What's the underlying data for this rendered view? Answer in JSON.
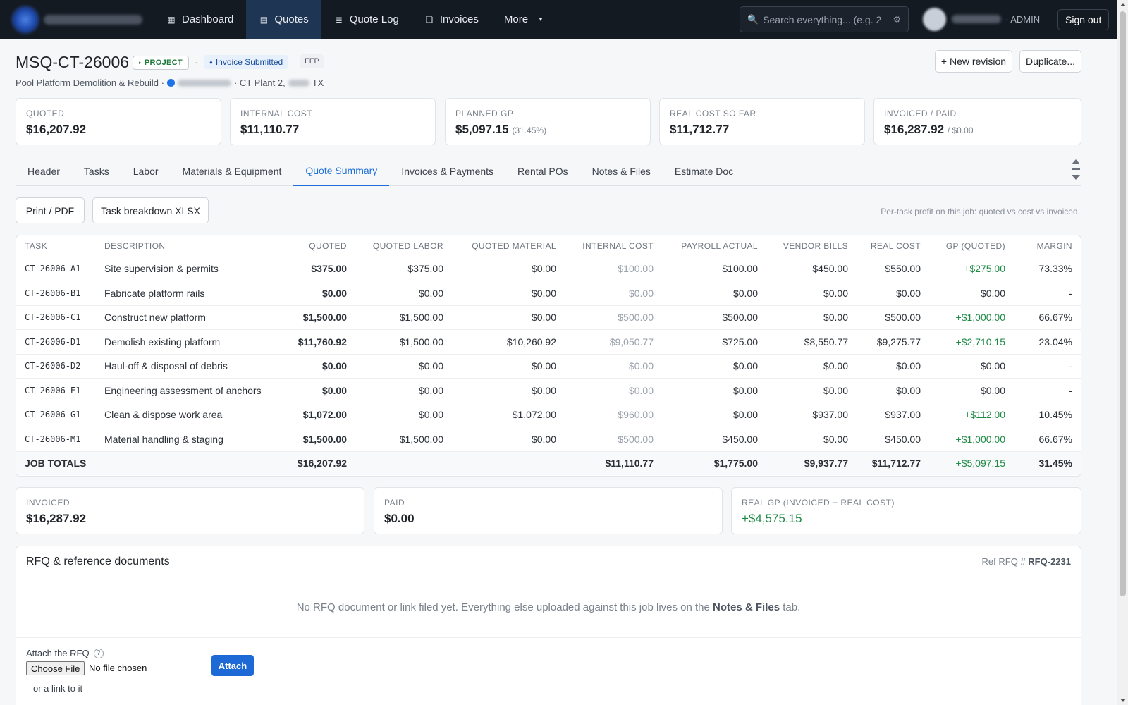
{
  "nav": {
    "items": [
      {
        "label": "Dashboard",
        "icon": "dashboard-icon",
        "glyph": "▦"
      },
      {
        "label": "Quotes",
        "icon": "quotes-icon",
        "glyph": "▤"
      },
      {
        "label": "Quote Log",
        "icon": "list-icon",
        "glyph": "≣"
      },
      {
        "label": "Invoices",
        "icon": "invoice-icon",
        "glyph": "❏"
      },
      {
        "label": "More",
        "icon": "",
        "glyph": ""
      }
    ],
    "search_placeholder": "Search everything... (e.g. 2",
    "role": "· ADMIN",
    "sign_out": "Sign out"
  },
  "job": {
    "id": "MSQ-CT-26006",
    "type_badge": "PROJECT",
    "sep": "·",
    "status_badge": "Invoice Submitted",
    "contract_badge": "FFP",
    "project_name": "Pool Platform Demolition & Rebuild ·",
    "site_label": "· CT Plant 2,",
    "state": "TX",
    "new_revision_label": "+ New revision",
    "duplicate_label": "Duplicate..."
  },
  "kpis": {
    "quoted": {
      "label": "QUOTED",
      "value": "$16,207.92"
    },
    "internal_cost": {
      "label": "INTERNAL COST",
      "value": "$11,110.77"
    },
    "planned_gp": {
      "label": "PLANNED GP",
      "value": "$5,097.15",
      "sub": "(31.45%)"
    },
    "real_cost": {
      "label": "REAL COST SO FAR",
      "value": "$11,712.77"
    },
    "invoiced_paid": {
      "label": "INVOICED / PAID",
      "value": "$16,287.92",
      "sub": "/ $0.00"
    }
  },
  "tabs": [
    "Header",
    "Tasks",
    "Labor",
    "Materials & Equipment",
    "Quote Summary",
    "Invoices & Payments",
    "Rental POs",
    "Notes & Files",
    "Estimate Doc"
  ],
  "actions": {
    "print_label": "Print / PDF",
    "xlsx_label": "Task breakdown XLSX",
    "helper": "Per-task profit on this job: quoted vs cost vs invoiced."
  },
  "table": {
    "headers": {
      "task": "TASK",
      "description": "DESCRIPTION",
      "quoted": "QUOTED",
      "quoted_labor": "QUOTED LABOR",
      "quoted_material": "QUOTED MATERIAL",
      "internal_cost": "INTERNAL COST",
      "payroll_actual": "PAYROLL ACTUAL",
      "vendor_bills": "VENDOR BILLS",
      "real_cost": "REAL COST",
      "gp_quoted": "GP (QUOTED)",
      "margin": "MARGIN"
    },
    "rows": [
      {
        "task": "CT-26006-A1",
        "description": "Site supervision & permits",
        "quoted": "$375.00",
        "quoted_labor": "$375.00",
        "quoted_material": "$0.00",
        "internal_cost": "$100.00",
        "payroll_actual": "$100.00",
        "vendor_bills": "$450.00",
        "real_cost": "$550.00",
        "gp_quoted": "+$275.00",
        "margin": "73.33%"
      },
      {
        "task": "CT-26006-B1",
        "description": "Fabricate platform rails",
        "quoted": "$0.00",
        "quoted_labor": "$0.00",
        "quoted_material": "$0.00",
        "internal_cost": "$0.00",
        "payroll_actual": "$0.00",
        "vendor_bills": "$0.00",
        "real_cost": "$0.00",
        "gp_quoted": "$0.00",
        "margin": "-"
      },
      {
        "task": "CT-26006-C1",
        "description": "Construct new platform",
        "quoted": "$1,500.00",
        "quoted_labor": "$1,500.00",
        "quoted_material": "$0.00",
        "internal_cost": "$500.00",
        "payroll_actual": "$500.00",
        "vendor_bills": "$0.00",
        "real_cost": "$500.00",
        "gp_quoted": "+$1,000.00",
        "margin": "66.67%"
      },
      {
        "task": "CT-26006-D1",
        "description": "Demolish existing platform",
        "quoted": "$11,760.92",
        "quoted_labor": "$1,500.00",
        "quoted_material": "$10,260.92",
        "internal_cost": "$9,050.77",
        "payroll_actual": "$725.00",
        "vendor_bills": "$8,550.77",
        "real_cost": "$9,275.77",
        "gp_quoted": "+$2,710.15",
        "margin": "23.04%"
      },
      {
        "task": "CT-26006-D2",
        "description": "Haul-off & disposal of debris",
        "quoted": "$0.00",
        "quoted_labor": "$0.00",
        "quoted_material": "$0.00",
        "internal_cost": "$0.00",
        "payroll_actual": "$0.00",
        "vendor_bills": "$0.00",
        "real_cost": "$0.00",
        "gp_quoted": "$0.00",
        "margin": "-"
      },
      {
        "task": "CT-26006-E1",
        "description": "Engineering assessment of anchors",
        "quoted": "$0.00",
        "quoted_labor": "$0.00",
        "quoted_material": "$0.00",
        "internal_cost": "$0.00",
        "payroll_actual": "$0.00",
        "vendor_bills": "$0.00",
        "real_cost": "$0.00",
        "gp_quoted": "$0.00",
        "margin": "-"
      },
      {
        "task": "CT-26006-G1",
        "description": "Clean & dispose work area",
        "quoted": "$1,072.00",
        "quoted_labor": "$0.00",
        "quoted_material": "$1,072.00",
        "internal_cost": "$960.00",
        "payroll_actual": "$0.00",
        "vendor_bills": "$937.00",
        "real_cost": "$937.00",
        "gp_quoted": "+$112.00",
        "margin": "10.45%"
      },
      {
        "task": "CT-26006-M1",
        "description": "Material handling & staging",
        "quoted": "$1,500.00",
        "quoted_labor": "$1,500.00",
        "quoted_material": "$0.00",
        "internal_cost": "$500.00",
        "payroll_actual": "$450.00",
        "vendor_bills": "$0.00",
        "real_cost": "$450.00",
        "gp_quoted": "+$1,000.00",
        "margin": "66.67%"
      }
    ],
    "totals": {
      "label": "JOB TOTALS",
      "quoted": "$16,207.92",
      "internal_cost": "$11,110.77",
      "payroll_actual": "$1,775.00",
      "vendor_bills": "$9,937.77",
      "real_cost": "$11,712.77",
      "gp_quoted": "+$5,097.15",
      "margin": "31.45%"
    }
  },
  "summary": {
    "invoiced": {
      "label": "INVOICED",
      "value": "$16,287.92"
    },
    "paid": {
      "label": "PAID",
      "value": "$0.00"
    },
    "real_gp": {
      "label": "REAL GP (INVOICED − REAL COST)",
      "value": "+$4,575.15"
    }
  },
  "rfq": {
    "title": "RFQ & reference documents",
    "ref_label": "Ref RFQ #",
    "ref_value": "RFQ-2231",
    "empty_text_1": "No RFQ document or link filed yet. Everything else uploaded against this job lives on the",
    "empty_link": "Notes & Files",
    "empty_text_2": "tab.",
    "attach_label": "Attach the RFQ",
    "help": "?",
    "choose_file": "Choose File",
    "no_file": "No file chosen",
    "attach_button": "Attach",
    "or_link": "or a link to it"
  },
  "colors": {
    "accent": "#1e6fd9",
    "nav_bg": "#141a22",
    "positive": "#1f8a45"
  }
}
